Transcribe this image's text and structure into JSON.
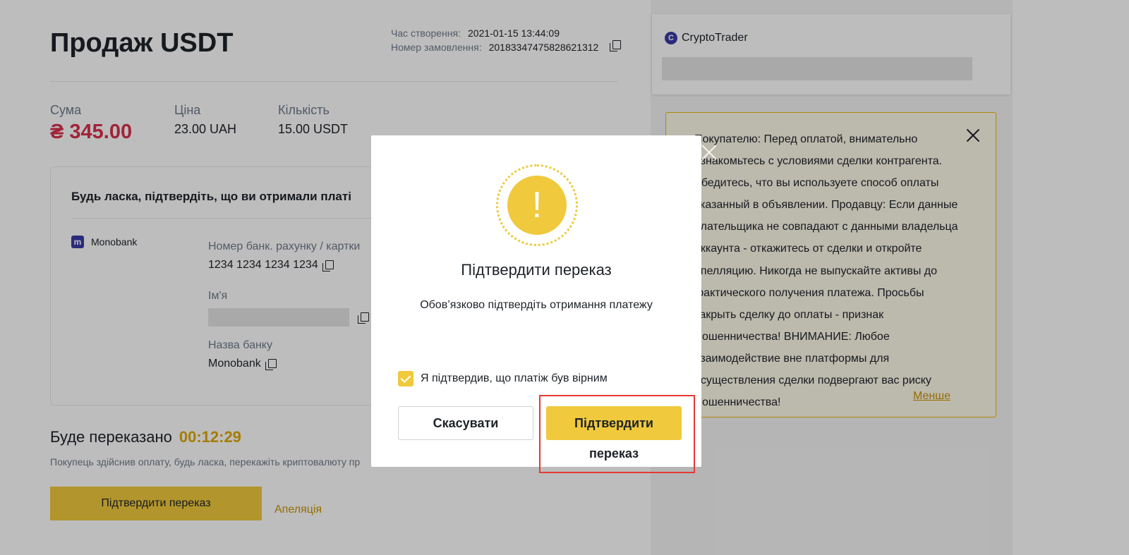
{
  "page": {
    "title": "Продаж USDT",
    "meta": {
      "created_label": "Час створення:",
      "created_value": "2021-01-15 13:44:09",
      "order_label": "Номер замовлення:",
      "order_value": "20183347475828621312"
    },
    "stats": {
      "sum_label": "Сума",
      "sum_value": "₴ 345.00",
      "price_label": "Ціна",
      "price_value": "23.00 UAH",
      "qty_label": "Кількість",
      "qty_value": "15.00 USDT"
    },
    "payment": {
      "heading": "Будь ласка, підтвердіть, що ви отримали платі",
      "method": "Monobank",
      "account_label": "Номер банк. рахунку / картки",
      "account_value": "1234 1234 1234 1234",
      "name_label": "Ім'я",
      "bank_label": "Назва банку",
      "bank_value": "Monobank"
    },
    "transfer": {
      "label": "Буде переказано",
      "timer": "00:12:29",
      "note": "Покупець здійснив оплату, будь ласка, перекажіть криптовалюту пр",
      "button": "Підтвердити переказ",
      "appeal": "Апеляція"
    }
  },
  "sidebar": {
    "trader_name": "CryptoTrader",
    "notice": "Покупателю: Перед оплатой, внимательно ознакомьтесь с условиями сделки контрагента. Убедитесь, что вы используете способ оплаты указанный в объявлении. Продавцу: Если данные плательщика не совпадают с данными владельца аккаунта - откажитесь от сделки и откройте апелляцию. Никогда не выпускайте активы до фактического получения платежа. Просьбы закрыть сделку до оплаты - признак мошенничества! ВНИМАНИЕ: Любое взаимодействие вне платформы для осуществления сделки подвергают вас риску мошенничества!",
    "less": "Менше"
  },
  "modal": {
    "title": "Підтвердити переказ",
    "subtitle": "Обов’язково підтвердіть отримання платежу",
    "checkbox_label": "Я підтвердив, що платіж був вірним",
    "cancel": "Скасувати",
    "confirm": "Підтвердити",
    "confirm_overflow": "переказ"
  },
  "colors": {
    "accent": "#f0c93c",
    "sum_red": "#d9304e",
    "highlight": "#e53935"
  }
}
